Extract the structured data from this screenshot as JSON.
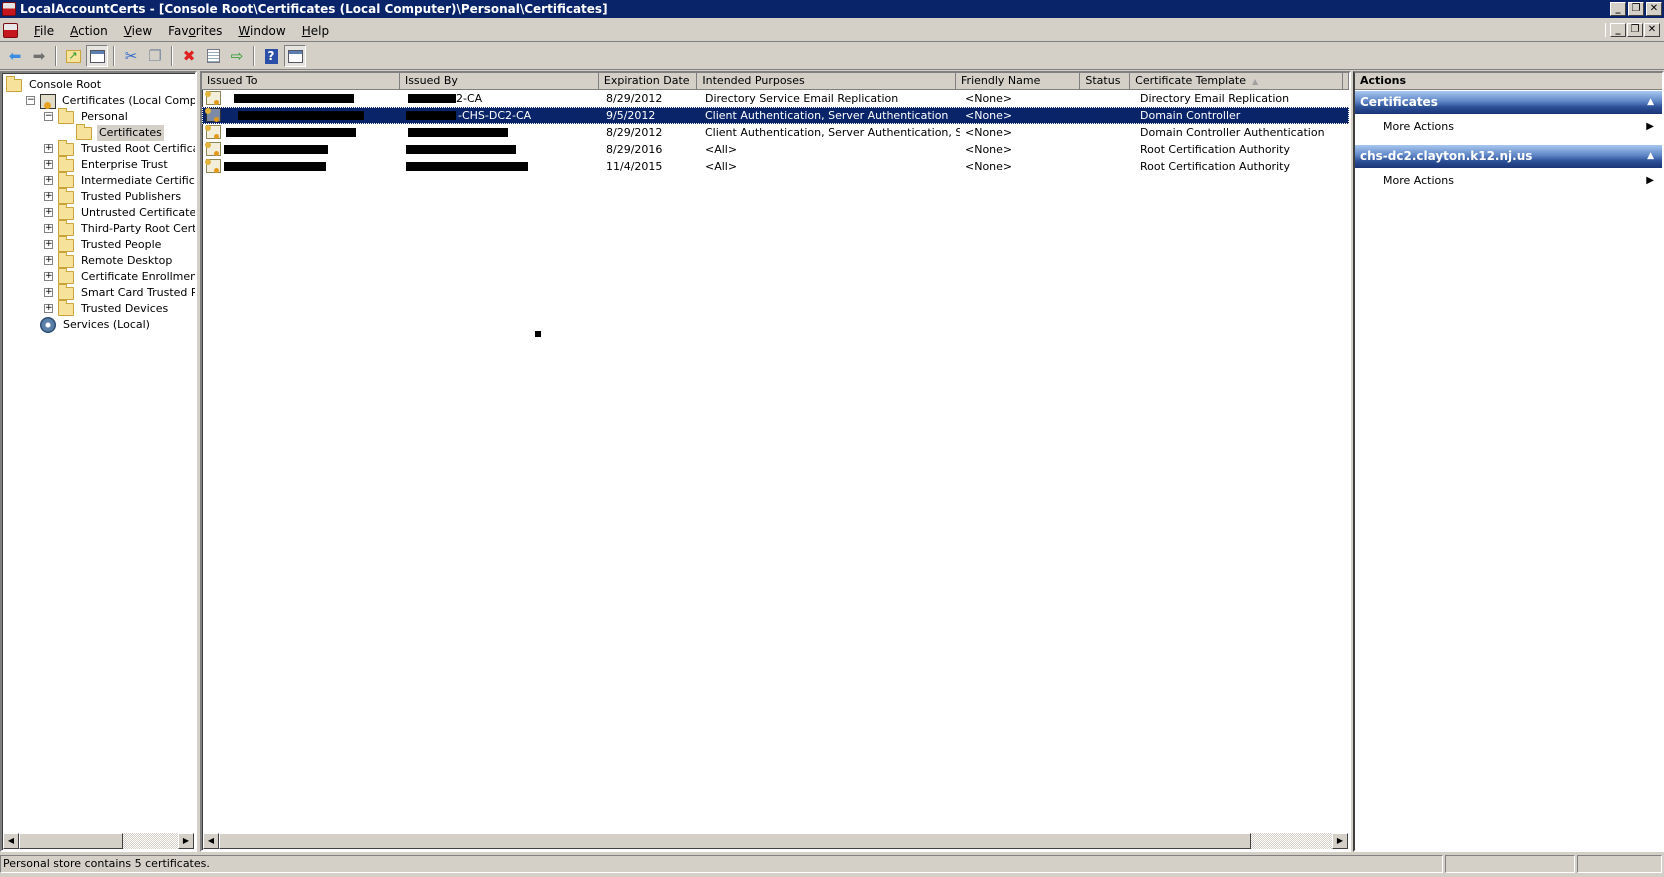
{
  "window": {
    "title": "LocalAccountCerts - [Console Root\\Certificates (Local Computer)\\Personal\\Certificates]",
    "caption_buttons": [
      "minimize",
      "restore",
      "close"
    ]
  },
  "menu": {
    "items": [
      {
        "label": "File",
        "accel": "F"
      },
      {
        "label": "Action",
        "accel": "A"
      },
      {
        "label": "View",
        "accel": "V"
      },
      {
        "label": "Favorites",
        "accel": "o"
      },
      {
        "label": "Window",
        "accel": "W"
      },
      {
        "label": "Help",
        "accel": "H"
      }
    ]
  },
  "toolbar": {
    "buttons": [
      {
        "name": "back",
        "icon": "back-arrow-icon",
        "glyph": "⬅"
      },
      {
        "name": "forward",
        "icon": "forward-arrow-icon",
        "glyph": "➡"
      },
      {
        "name": "up-one-level",
        "icon": "folder-up-icon",
        "glyph": "📂"
      },
      {
        "name": "show-hide-console-tree",
        "icon": "console-tree-icon",
        "glyph": "▤"
      },
      {
        "name": "cut",
        "icon": "scissors-icon",
        "glyph": "✂"
      },
      {
        "name": "copy",
        "icon": "copy-icon",
        "glyph": "❐"
      },
      {
        "name": "delete",
        "icon": "delete-x-icon",
        "glyph": "✖"
      },
      {
        "name": "properties",
        "icon": "properties-icon",
        "glyph": "▦"
      },
      {
        "name": "export-list",
        "icon": "export-list-icon",
        "glyph": "⇨"
      },
      {
        "name": "help",
        "icon": "help-icon",
        "glyph": "?"
      },
      {
        "name": "show-hide-action-pane",
        "icon": "action-pane-icon",
        "glyph": "▥"
      }
    ]
  },
  "tree": {
    "items": [
      {
        "label": "Console Root",
        "level": 0,
        "icon": "folder",
        "expander": null
      },
      {
        "label": "Certificates (Local Computer)",
        "level": 1,
        "icon": "cert-store",
        "expander": "-"
      },
      {
        "label": "Personal",
        "level": 2,
        "icon": "folder",
        "expander": "-"
      },
      {
        "label": "Certificates",
        "level": 3,
        "icon": "folder",
        "expander": null,
        "selected": true
      },
      {
        "label": "Trusted Root Certification Authorities",
        "level": 2,
        "icon": "folder",
        "expander": "+"
      },
      {
        "label": "Enterprise Trust",
        "level": 2,
        "icon": "folder",
        "expander": "+"
      },
      {
        "label": "Intermediate Certification Authorities",
        "level": 2,
        "icon": "folder",
        "expander": "+"
      },
      {
        "label": "Trusted Publishers",
        "level": 2,
        "icon": "folder",
        "expander": "+"
      },
      {
        "label": "Untrusted Certificates",
        "level": 2,
        "icon": "folder",
        "expander": "+"
      },
      {
        "label": "Third-Party Root Certification Authorities",
        "level": 2,
        "icon": "folder",
        "expander": "+"
      },
      {
        "label": "Trusted People",
        "level": 2,
        "icon": "folder",
        "expander": "+"
      },
      {
        "label": "Remote Desktop",
        "level": 2,
        "icon": "folder",
        "expander": "+"
      },
      {
        "label": "Certificate Enrollment Requests",
        "level": 2,
        "icon": "folder",
        "expander": "+"
      },
      {
        "label": "Smart Card Trusted Roots",
        "level": 2,
        "icon": "folder",
        "expander": "+"
      },
      {
        "label": "Trusted Devices",
        "level": 2,
        "icon": "folder",
        "expander": "+"
      },
      {
        "label": "Services (Local)",
        "level": 1,
        "icon": "gear",
        "expander": null
      }
    ]
  },
  "list": {
    "columns": [
      "Issued To",
      "Issued By",
      "Expiration Date",
      "Intended Purposes",
      "Friendly Name",
      "Status",
      "Certificate Template"
    ],
    "sorted_column": "Certificate Template",
    "rows": [
      {
        "issued_to": "[redacted]",
        "issued_by": "2-CA",
        "expiration": "8/29/2012",
        "purposes": "Directory Service Email Replication",
        "friendly": "<None>",
        "status": "",
        "template": "Directory Email Replication",
        "selected": false
      },
      {
        "issued_to": "[redacted]",
        "issued_by": "-CHS-DC2-CA",
        "expiration": "9/5/2012",
        "purposes": "Client Authentication, Server Authentication",
        "friendly": "<None>",
        "status": "",
        "template": "Domain Controller",
        "selected": true
      },
      {
        "issued_to": "[redacted]",
        "issued_by": "[redacted]",
        "expiration": "8/29/2012",
        "purposes": "Client Authentication, Server Authentication, Sm...",
        "friendly": "<None>",
        "status": "",
        "template": "Domain Controller Authentication",
        "selected": false
      },
      {
        "issued_to": "[redacted]",
        "issued_by": "[redacted]",
        "expiration": "8/29/2016",
        "purposes": "<All>",
        "friendly": "<None>",
        "status": "",
        "template": "Root Certification Authority",
        "selected": false
      },
      {
        "issued_to": "[redacted]",
        "issued_by": "[redacted]",
        "expiration": "11/4/2015",
        "purposes": "<All>",
        "friendly": "<None>",
        "status": "",
        "template": "Root Certification Authority",
        "selected": false
      }
    ]
  },
  "actions": {
    "header": "Actions",
    "sections": [
      {
        "title": "Certificates",
        "items": [
          "More Actions"
        ]
      },
      {
        "title": "chs-dc2.clayton.k12.nj.us",
        "items": [
          "More Actions"
        ]
      }
    ]
  },
  "status": {
    "text": "Personal store contains 5 certificates."
  },
  "colors": {
    "title_bar": "#0a246a",
    "selection": "#0a246a",
    "face": "#d4d0c8",
    "action_header_top": "#a8c8f0",
    "action_header_bottom": "#1a3577"
  }
}
